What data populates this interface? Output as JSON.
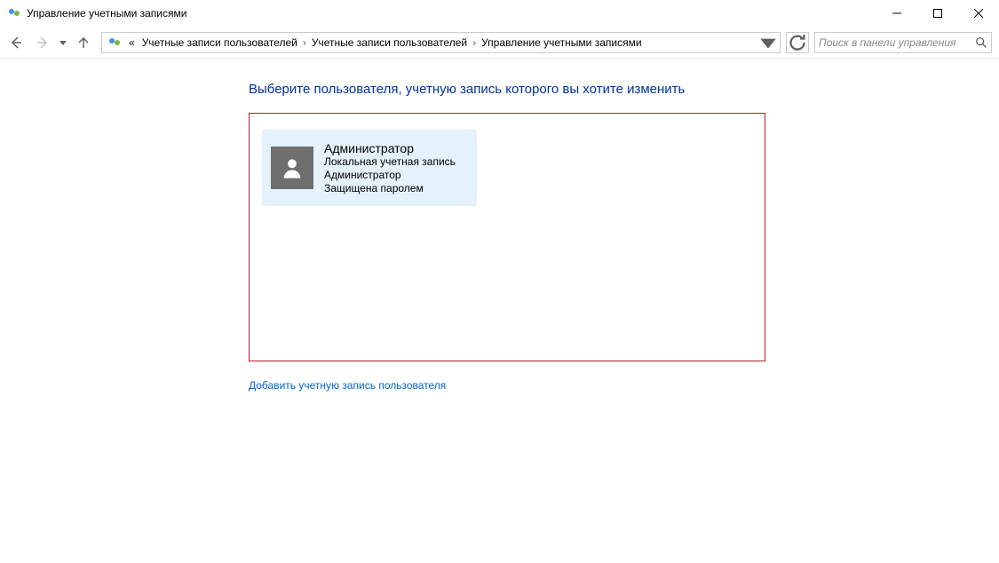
{
  "window": {
    "title": "Управление учетными записями"
  },
  "breadcrumb": {
    "prefix": "«",
    "items": [
      "Учетные записи пользователей",
      "Учетные записи пользователей",
      "Управление учетными записями"
    ]
  },
  "search": {
    "placeholder": "Поиск в панели управления"
  },
  "main": {
    "heading": "Выберите пользователя, учетную запись которого вы хотите изменить",
    "account": {
      "name": "Администратор",
      "line1": "Локальная учетная запись",
      "line2": "Администратор",
      "line3": "Защищена паролем"
    },
    "add_link": "Добавить учетную запись пользователя"
  }
}
